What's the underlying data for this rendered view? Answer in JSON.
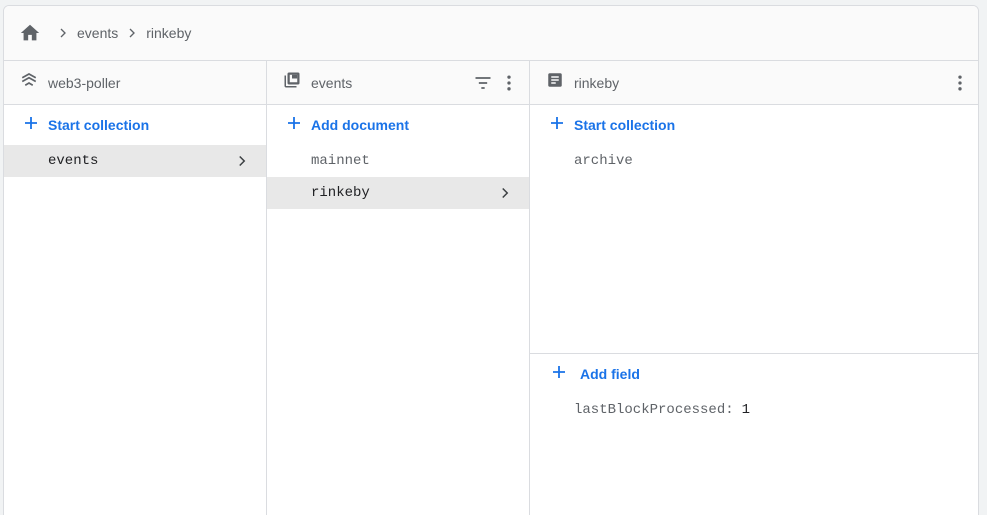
{
  "breadcrumb": {
    "home_icon": "home-icon",
    "items": [
      "events",
      "rinkeby"
    ]
  },
  "panels": {
    "root": {
      "title": "web3-poller",
      "icon": "database-icon",
      "action_label": "Start collection",
      "items": [
        {
          "label": "events",
          "selected": true
        }
      ]
    },
    "collection": {
      "title": "events",
      "icon": "collection-icon",
      "action_label": "Add document",
      "items": [
        {
          "label": "mainnet",
          "selected": false
        },
        {
          "label": "rinkeby",
          "selected": true
        }
      ]
    },
    "document": {
      "title": "rinkeby",
      "icon": "document-icon",
      "action_label": "Start collection",
      "subcollections": [
        "archive"
      ],
      "field_action_label": "Add field",
      "fields": [
        {
          "key": "lastBlockProcessed:",
          "value": "1"
        }
      ]
    }
  },
  "colors": {
    "accent": "#1a73e8",
    "selected_bg": "#e8e8e8",
    "border": "#dadce0"
  }
}
